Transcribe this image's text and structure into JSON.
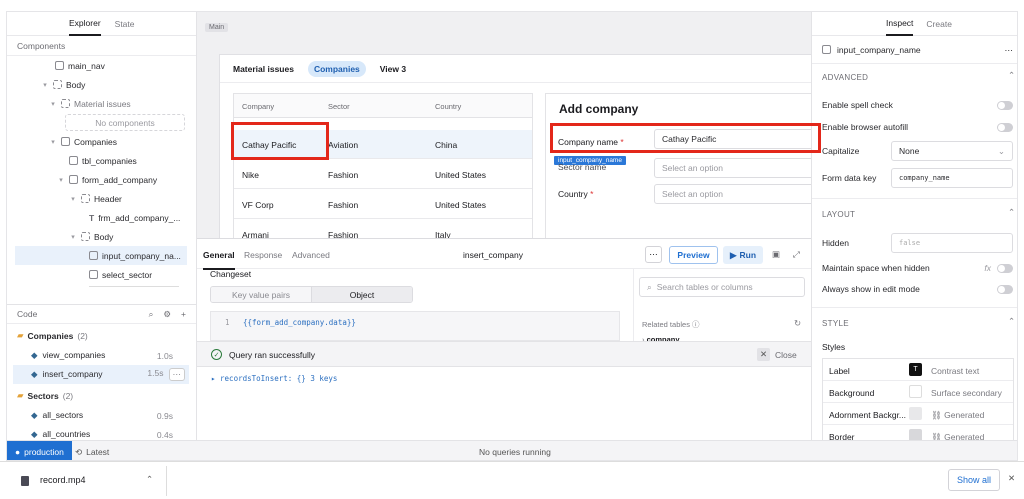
{
  "left": {
    "tabs": [
      "Explorer",
      "State"
    ],
    "components_label": "Components",
    "tree": [
      {
        "label": "main_nav"
      },
      {
        "label": "Body"
      },
      {
        "label": "Material issues"
      },
      {
        "label": "No components"
      },
      {
        "label": "Companies"
      },
      {
        "label": "tbl_companies"
      },
      {
        "label": "form_add_company"
      },
      {
        "label": "Header"
      },
      {
        "label": "frm_add_company_..."
      },
      {
        "label": "Body"
      },
      {
        "label": "input_company_na..."
      },
      {
        "label": "select_sector"
      }
    ],
    "code_label": "Code",
    "code": {
      "groups": [
        {
          "name": "Companies",
          "count": "(2)",
          "items": [
            {
              "name": "view_companies",
              "time": "1.0s"
            },
            {
              "name": "insert_company",
              "time": "1.5s"
            }
          ]
        },
        {
          "name": "Sectors",
          "count": "(2)",
          "items": [
            {
              "name": "all_sectors",
              "time": "0.9s"
            },
            {
              "name": "all_countries",
              "time": "0.4s"
            }
          ]
        }
      ]
    }
  },
  "center": {
    "main_label": "Main",
    "tabs": [
      "Material issues",
      "Companies",
      "View 3"
    ],
    "table": {
      "headers": [
        "Company",
        "Sector",
        "Country"
      ],
      "rows": [
        [
          "Cathay Pacific",
          "Aviation",
          "China"
        ],
        [
          "Nike",
          "Fashion",
          "United States"
        ],
        [
          "VF Corp",
          "Fashion",
          "United States"
        ],
        [
          "Armani",
          "Fashion",
          "Italy"
        ]
      ]
    },
    "form": {
      "title": "Add company",
      "company_label": "Company name",
      "company_value": "Cathay Pacific",
      "badge": "input_company_name",
      "sector_label": "Sector name",
      "sector_placeholder": "Select an option",
      "country_label": "Country",
      "country_placeholder": "Select an option",
      "required": "*"
    },
    "query": {
      "tabs": [
        "General",
        "Response",
        "Advanced"
      ],
      "title": "insert_company",
      "preview": "Preview",
      "run": "Run",
      "changeset": "Changeset",
      "seg": [
        "Key value pairs",
        "Object"
      ],
      "line_no": "1",
      "code": "{{form_add_company.data}}",
      "search_placeholder": "Search tables or columns",
      "related": "Related tables",
      "company_rel": "company",
      "success": "Query ran successfully",
      "close": "Close",
      "records": "recordsToInsert: {} 3 keys"
    }
  },
  "right": {
    "tabs": [
      "Inspect",
      "Create"
    ],
    "component": "input_company_name",
    "advanced": "ADVANCED",
    "spell": "Enable spell check",
    "autofill": "Enable browser autofill",
    "capitalize": "Capitalize",
    "capitalize_val": "None",
    "formkey": "Form data key",
    "formkey_val": "company_name",
    "layout": "LAYOUT",
    "hidden": "Hidden",
    "hidden_val": "false",
    "maintain": "Maintain space when hidden",
    "fx": "fx",
    "always": "Always show in edit mode",
    "style": "STYLE",
    "styles": "Styles",
    "style_rows": [
      {
        "name": "Label",
        "value": "Contrast text",
        "swatch": "#111111"
      },
      {
        "name": "Background",
        "value": "Surface secondary",
        "swatch": "#ffffff"
      },
      {
        "name": "Adornment Backgr...",
        "value": "Generated",
        "swatch": "#e8e8ea"
      },
      {
        "name": "Border",
        "value": "Generated",
        "swatch": "#d8d8db"
      }
    ]
  },
  "bottombar": {
    "env": "production",
    "latest": "Latest",
    "status": "No queries running"
  },
  "download": {
    "file": "record.mp4",
    "show_all": "Show all"
  },
  "colors": {
    "accent": "#1f6fd1",
    "red": "#e3271a",
    "success": "#2a7a3b"
  }
}
